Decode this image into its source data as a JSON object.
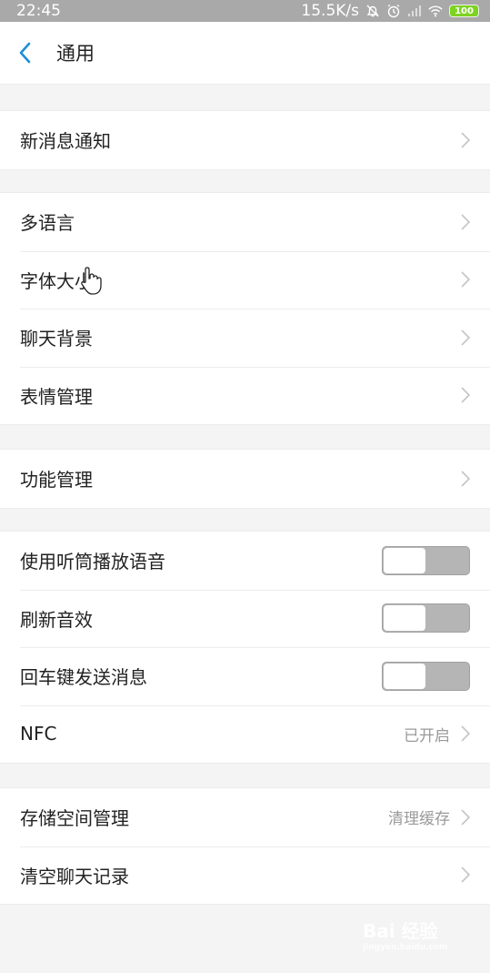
{
  "status": {
    "time": "22:45",
    "net_speed": "15.5K/s",
    "battery": "100",
    "icons": [
      "bell-off-icon",
      "alarm-icon",
      "signal-icon",
      "wifi-icon",
      "battery-icon"
    ]
  },
  "header": {
    "title": "通用",
    "back_icon": "chevron-left-icon"
  },
  "groups": [
    {
      "items": [
        {
          "label": "新消息通知"
        }
      ]
    },
    {
      "items": [
        {
          "label": "多语言"
        },
        {
          "label": "字体大小"
        },
        {
          "label": "聊天背景"
        },
        {
          "label": "表情管理"
        }
      ]
    },
    {
      "items": [
        {
          "label": "功能管理"
        }
      ]
    },
    {
      "items": [
        {
          "label": "使用听筒播放语音",
          "toggle": false
        },
        {
          "label": "刷新音效",
          "toggle": false
        },
        {
          "label": "回车键发送消息",
          "toggle": false
        },
        {
          "label": "NFC",
          "value": "已开启"
        }
      ]
    },
    {
      "items": [
        {
          "label": "存储空间管理",
          "value": "清理缓存"
        },
        {
          "label": "清空聊天记录"
        }
      ]
    }
  ],
  "colors": {
    "accent": "#1e8ed8",
    "toggle_off": "#b5b5b5",
    "battery": "#7ed321"
  },
  "watermark": {
    "text": "Bai 经验",
    "sub": "jingyan.baidu.com"
  }
}
